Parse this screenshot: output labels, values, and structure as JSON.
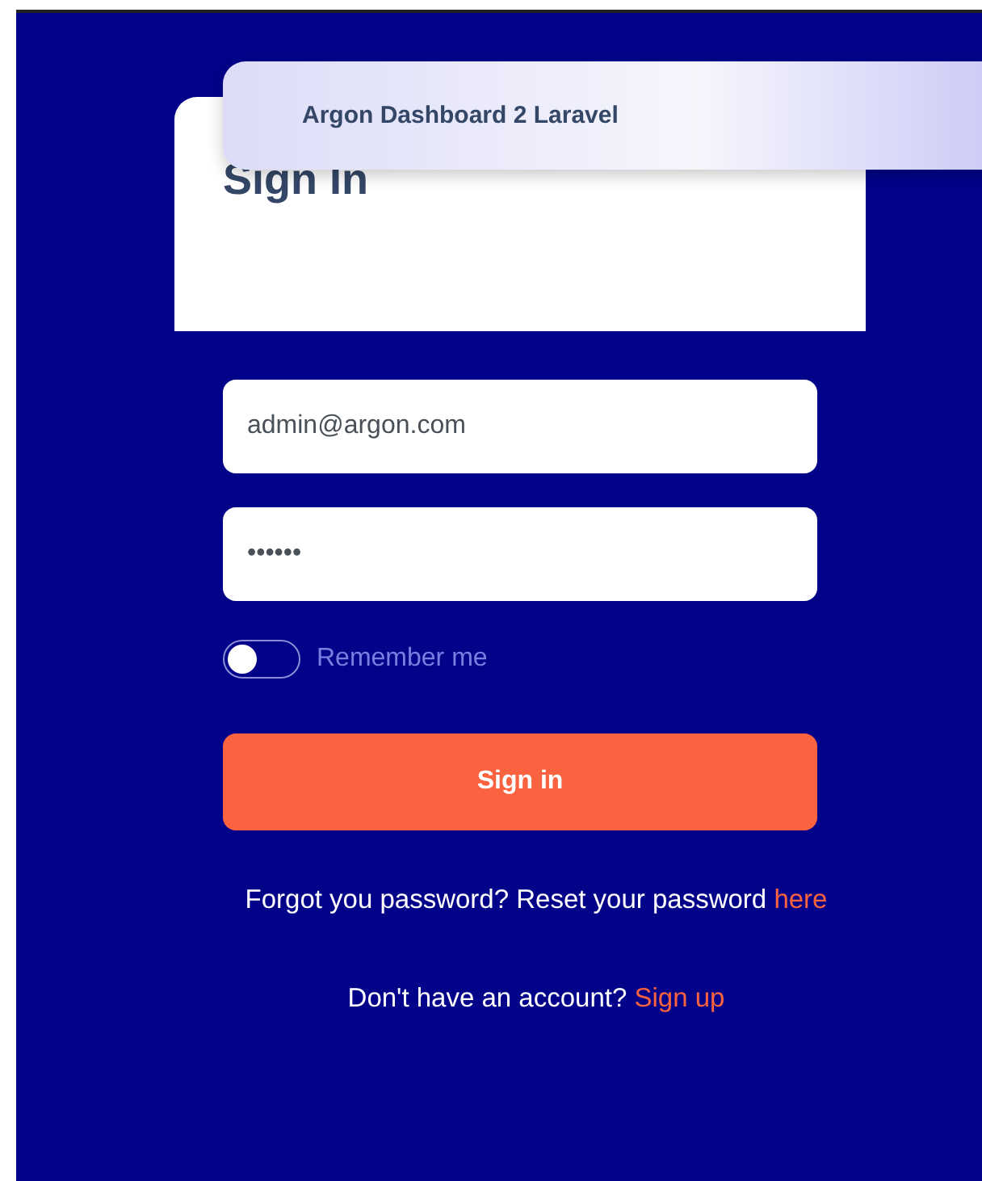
{
  "navbar": {
    "brand": "Argon Dashboard 2 Laravel"
  },
  "card": {
    "title": "Sign In"
  },
  "form": {
    "email": {
      "value": "admin@argon.com"
    },
    "password": {
      "value": "••••••"
    },
    "remember": {
      "label": "Remember me",
      "checked": false
    },
    "submit": "Sign in"
  },
  "links": [
    {
      "text": "Forgot you password? Reset your password ",
      "link": "here"
    },
    {
      "text": "Don't have an account? ",
      "link": "Sign up"
    }
  ]
}
